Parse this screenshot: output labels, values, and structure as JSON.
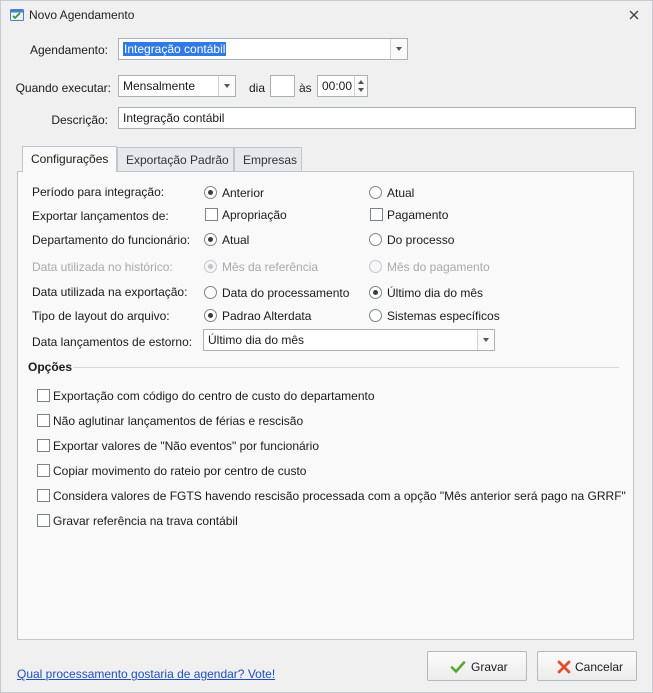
{
  "window": {
    "title": "Novo Agendamento"
  },
  "form": {
    "agendamento_label": "Agendamento:",
    "agendamento_value": "Integração contábil",
    "quando_label": "Quando executar:",
    "frequencia_value": "Mensalmente",
    "dia_label": "dia",
    "dia_value": "",
    "as_label": "às",
    "hora_value": "00:00",
    "descricao_label": "Descrição:",
    "descricao_value": "Integração contábil"
  },
  "tabs": [
    {
      "label": "Configurações",
      "active": true
    },
    {
      "label": "Exportação Padrão",
      "active": false
    },
    {
      "label": "Empresas",
      "active": false
    }
  ],
  "config": {
    "rows": [
      {
        "label": "Período para integração:",
        "opt1": "Anterior",
        "opt2": "Atual"
      },
      {
        "label": "Exportar lançamentos de:",
        "opt1": "Apropriação",
        "opt2": "Pagamento"
      },
      {
        "label": "Departamento do funcionário:",
        "opt1": "Atual",
        "opt2": "Do processo"
      },
      {
        "label": "Data utilizada no histórico:",
        "opt1": "Mês da referência",
        "opt2": "Mês do pagamento"
      },
      {
        "label": "Data utilizada na exportação:",
        "opt1": "Data do processamento",
        "opt2": "Último dia do mês"
      },
      {
        "label": "Tipo de layout do arquivo:",
        "opt1": "Padrao Alterdata",
        "opt2": "Sistemas específicos"
      }
    ],
    "estorno_label": "Data lançamentos de estorno:",
    "estorno_value": "Último dia do mês"
  },
  "opcoes": {
    "title": "Opções",
    "items": [
      "Exportação com código do centro de custo do departamento",
      "Não aglutinar lançamentos de férias e rescisão",
      "Exportar valores de \"Não eventos\" por funcionário",
      "Copiar movimento do rateio por centro de custo",
      "Considera valores de FGTS havendo rescisão processada com a opção \"Mês anterior será pago na GRRF\"",
      "Gravar referência na trava contábil"
    ]
  },
  "footer": {
    "link_text": "Qual processamento gostaria de agendar? Vote!",
    "save_label": "Gravar",
    "cancel_label": "Cancelar"
  },
  "colors": {
    "accent": "#2f7ae5",
    "link": "#1f4fbf",
    "save_icon": "#56a832",
    "cancel_icon": "#e0502a"
  }
}
